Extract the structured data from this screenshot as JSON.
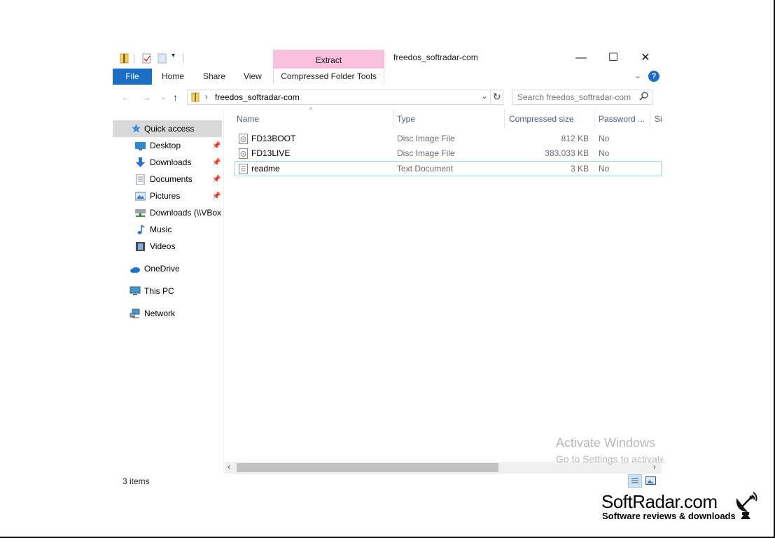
{
  "titlebar": {
    "title": "freedos_softradar-com",
    "contextual_tab": "Extract",
    "minimize": "—",
    "maximize": "☐",
    "close": "✕"
  },
  "ribbon": {
    "tabs": [
      "File",
      "Home",
      "Share",
      "View"
    ],
    "contextual_label": "Compressed Folder Tools",
    "help": "?"
  },
  "nav": {
    "back": "←",
    "forward": "→",
    "recent": "⌄",
    "up": "↑",
    "path": "freedos_softradar-com",
    "refresh": "↻",
    "search_placeholder": "Search freedos_softradar-com"
  },
  "sidebar": {
    "quick_access": "Quick access",
    "items": [
      {
        "label": "Desktop",
        "pinned": true,
        "icon": "desktop-icon"
      },
      {
        "label": "Downloads",
        "pinned": true,
        "icon": "downloads-icon"
      },
      {
        "label": "Documents",
        "pinned": true,
        "icon": "documents-icon"
      },
      {
        "label": "Pictures",
        "pinned": true,
        "icon": "pictures-icon"
      },
      {
        "label": "Downloads (\\\\VBox",
        "pinned": false,
        "icon": "network-drive-icon"
      },
      {
        "label": "Music",
        "pinned": false,
        "icon": "music-icon"
      },
      {
        "label": "Videos",
        "pinned": false,
        "icon": "videos-icon"
      }
    ],
    "onedrive": "OneDrive",
    "thispc": "This PC",
    "network": "Network"
  },
  "columns": {
    "name": "Name",
    "type": "Type",
    "size": "Compressed size",
    "password": "Password ...",
    "extra": "Si"
  },
  "files": [
    {
      "name": "FD13BOOT",
      "type": "Disc Image File",
      "size": "812 KB",
      "password": "No",
      "icon": "disc-image-icon"
    },
    {
      "name": "FD13LIVE",
      "type": "Disc Image File",
      "size": "383,033 KB",
      "password": "No",
      "icon": "disc-image-icon"
    },
    {
      "name": "readme",
      "type": "Text Document",
      "size": "3 KB",
      "password": "No",
      "icon": "text-document-icon"
    }
  ],
  "status": {
    "count": "3 items"
  },
  "watermark": {
    "line1": "Activate Windows",
    "line2": "Go to Settings to activate Windows."
  },
  "brand": {
    "name": "SoftRadar.com",
    "tagline": "Software reviews & downloads"
  },
  "colors": {
    "accent": "#1a6ec5",
    "contextual_tab": "#f8c0dc",
    "selection": "#d9d9d9"
  }
}
